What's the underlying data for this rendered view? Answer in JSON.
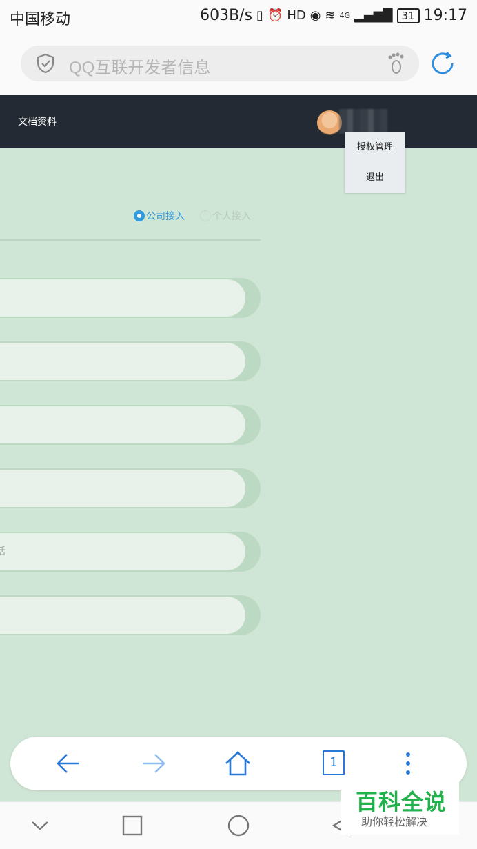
{
  "status_bar": {
    "carrier": "中国移动",
    "speed": "603B/s",
    "network": "4G",
    "battery": "31",
    "time": "19:17"
  },
  "browser": {
    "url_placeholder": "QQ互联开发者信息"
  },
  "navbar": {
    "docs_label": "文档资料"
  },
  "dropdown": {
    "items": [
      {
        "label": "授权管理"
      },
      {
        "label": "退出"
      }
    ]
  },
  "form": {
    "access_type": {
      "options": [
        {
          "label": "公司接入",
          "selected": true
        },
        {
          "label": "个人接入",
          "selected": false
        }
      ]
    },
    "fields": [
      {
        "value": ""
      },
      {
        "value": ""
      },
      {
        "value": ""
      },
      {
        "value": ""
      },
      {
        "value": "话"
      },
      {
        "value": ""
      }
    ]
  },
  "toolbar": {
    "tab_count": "1"
  },
  "watermark": {
    "title": "百科全说",
    "subtitle": "助你轻松解决"
  },
  "colors": {
    "accent": "#2e9be0",
    "navbar": "#232a33",
    "page_bg": "#cfe5d5",
    "browser_blue": "#2878d8",
    "watermark_green": "#22b24c"
  }
}
